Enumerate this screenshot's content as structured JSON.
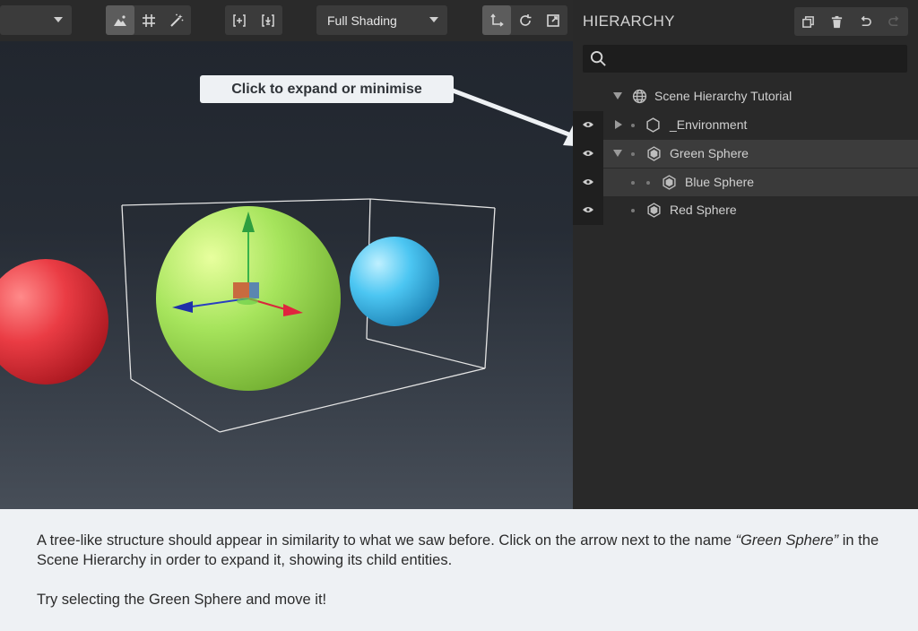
{
  "toolbar": {
    "camera_dropdown": "",
    "shading_dropdown": "Full Shading"
  },
  "callout": {
    "text": "Click to expand or minimise"
  },
  "hierarchy": {
    "title": "HIERARCHY",
    "search_placeholder": "",
    "items": [
      {
        "label": "Scene Hierarchy Tutorial"
      },
      {
        "label": "_Environment"
      },
      {
        "label": "Green Sphere"
      },
      {
        "label": "Blue Sphere"
      },
      {
        "label": "Red Sphere"
      }
    ]
  },
  "instructions": {
    "p1_before": "A tree-like structure should appear in similarity to what we saw before. Click on the arrow next to the name ",
    "p1_em": "“Green Sphere”",
    "p1_after": " in the Scene Hierarchy in order to expand it, showing its child entities.",
    "p2": "Try selecting the Green Sphere and move it!"
  },
  "colors": {
    "green_sphere": "#a3e35a",
    "blue_sphere": "#4cc6f2",
    "red_sphere": "#e8383f"
  }
}
